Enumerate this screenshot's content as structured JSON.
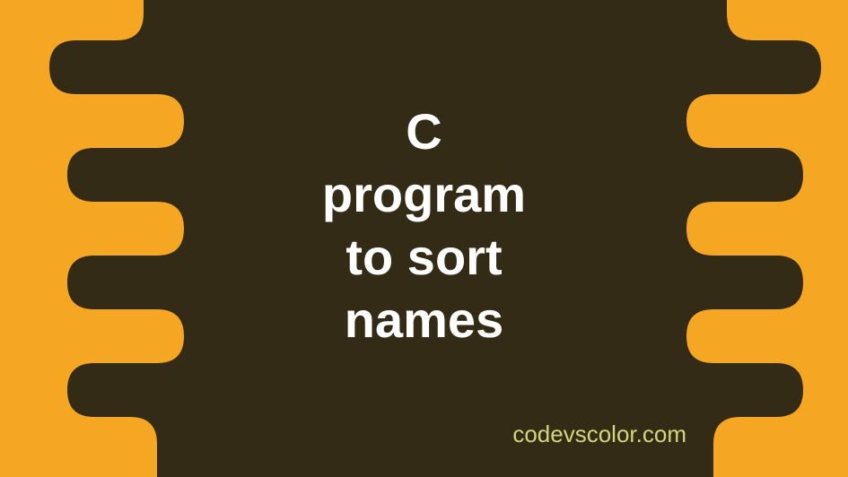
{
  "title_lines": "C\nprogram\nto sort\nnames",
  "credit": "codevscolor.com",
  "colors": {
    "background": "#f5a623",
    "blob": "#332b16",
    "title_text": "#ffffff",
    "credit_text": "#d4d47a"
  }
}
